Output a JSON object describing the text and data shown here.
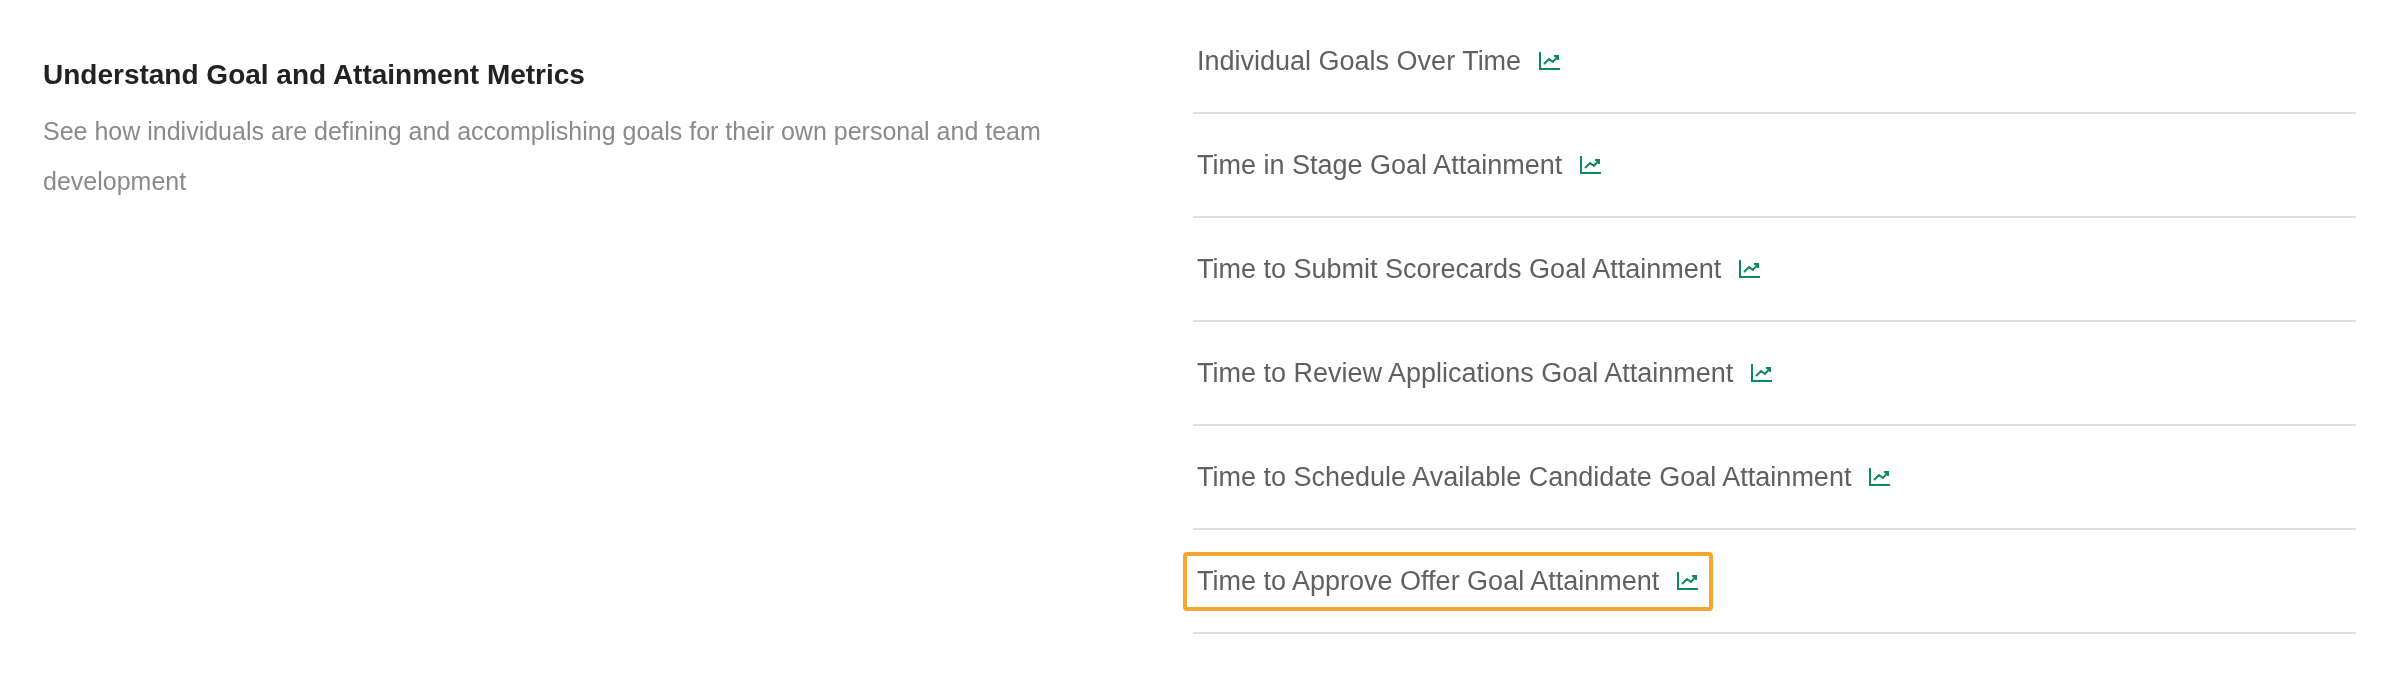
{
  "section": {
    "title": "Understand Goal and Attainment Metrics",
    "description": "See how individuals are defining and accomplishing goals for their own personal and team development"
  },
  "reports": [
    {
      "label": "Individual Goals Over Time",
      "highlighted": false
    },
    {
      "label": "Time in Stage Goal Attainment",
      "highlighted": false
    },
    {
      "label": "Time to Submit Scorecards Goal Attainment",
      "highlighted": false
    },
    {
      "label": "Time to Review Applications Goal Attainment",
      "highlighted": false
    },
    {
      "label": "Time to Schedule Available Candidate Goal Attainment",
      "highlighted": false
    },
    {
      "label": "Time to Approve Offer Goal Attainment",
      "highlighted": true
    }
  ]
}
